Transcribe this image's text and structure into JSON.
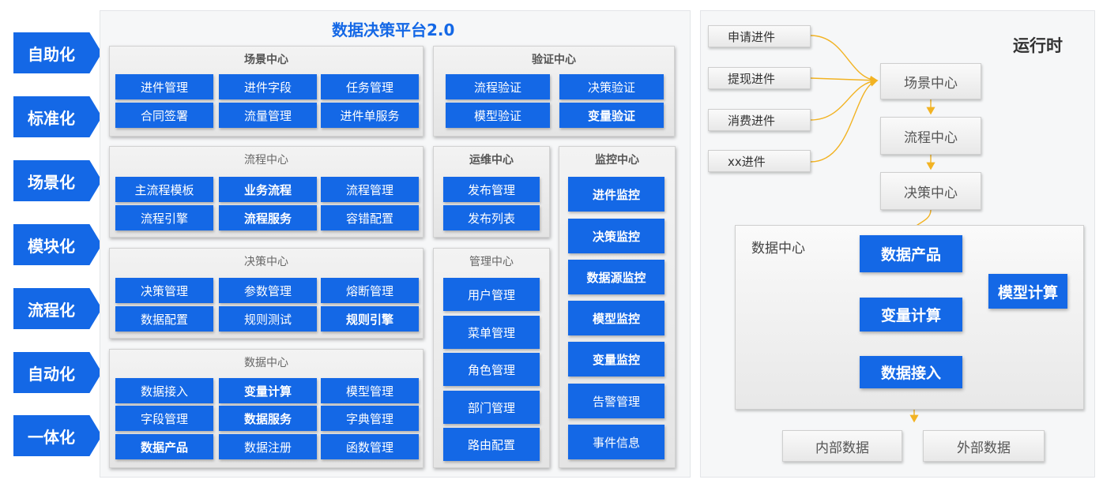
{
  "title": "数据决策平台2.0",
  "left_labels": [
    "自助化",
    "标准化",
    "场景化",
    "模块化",
    "流程化",
    "自动化",
    "一体化"
  ],
  "scene_center": {
    "title": "场景中心",
    "items": [
      {
        "label": "进件管理",
        "bold": false
      },
      {
        "label": "进件字段",
        "bold": false
      },
      {
        "label": "任务管理",
        "bold": false
      },
      {
        "label": "合同签署",
        "bold": false
      },
      {
        "label": "流量管理",
        "bold": false
      },
      {
        "label": "进件单服务",
        "bold": false
      }
    ]
  },
  "verify_center": {
    "title": "验证中心",
    "items": [
      {
        "label": "流程验证",
        "bold": false
      },
      {
        "label": "决策验证",
        "bold": false
      },
      {
        "label": "模型验证",
        "bold": false
      },
      {
        "label": "变量验证",
        "bold": true
      }
    ]
  },
  "flow_center": {
    "title": "流程中心",
    "items": [
      {
        "label": "主流程模板",
        "bold": false
      },
      {
        "label": "业务流程",
        "bold": true
      },
      {
        "label": "流程管理",
        "bold": false
      },
      {
        "label": "流程引擎",
        "bold": false
      },
      {
        "label": "流程服务",
        "bold": true
      },
      {
        "label": "容错配置",
        "bold": false
      }
    ]
  },
  "ops_center": {
    "title": "运维中心",
    "items": [
      {
        "label": "发布管理",
        "bold": false
      },
      {
        "label": "发布列表",
        "bold": false
      }
    ]
  },
  "monitor_center": {
    "title": "监控中心",
    "items": [
      {
        "label": "进件监控",
        "bold": true
      },
      {
        "label": "决策监控",
        "bold": true
      },
      {
        "label": "数据源监控",
        "bold": true
      },
      {
        "label": "模型监控",
        "bold": true
      },
      {
        "label": "变量监控",
        "bold": true
      },
      {
        "label": "告警管理",
        "bold": false
      },
      {
        "label": "事件信息",
        "bold": false
      }
    ]
  },
  "decision_center": {
    "title": "决策中心",
    "items": [
      {
        "label": "决策管理",
        "bold": false
      },
      {
        "label": "参数管理",
        "bold": false
      },
      {
        "label": "熔断管理",
        "bold": false
      },
      {
        "label": "数据配置",
        "bold": false
      },
      {
        "label": "规则测试",
        "bold": false
      },
      {
        "label": "规则引擎",
        "bold": true
      }
    ]
  },
  "manage_center": {
    "title": "管理中心",
    "items": [
      {
        "label": "用户管理",
        "bold": false
      },
      {
        "label": "菜单管理",
        "bold": false
      },
      {
        "label": "角色管理",
        "bold": false
      },
      {
        "label": "部门管理",
        "bold": false
      },
      {
        "label": "路由配置",
        "bold": false
      }
    ]
  },
  "data_center": {
    "title": "数据中心",
    "items": [
      {
        "label": "数据接入",
        "bold": false
      },
      {
        "label": "变量计算",
        "bold": true
      },
      {
        "label": "模型管理",
        "bold": false
      },
      {
        "label": "字段管理",
        "bold": false
      },
      {
        "label": "数据服务",
        "bold": true
      },
      {
        "label": "字典管理",
        "bold": false
      },
      {
        "label": "数据产品",
        "bold": true
      },
      {
        "label": "数据注册",
        "bold": false
      },
      {
        "label": "函数管理",
        "bold": false
      }
    ]
  },
  "runtime": {
    "title": "运行时",
    "inputs": [
      "申请进件",
      "提现进件",
      "消费进件",
      "xx进件"
    ],
    "chain": [
      "场景中心",
      "流程中心",
      "决策中心"
    ],
    "data_center": {
      "title": "数据中心",
      "product": "数据产品",
      "variable": "变量计算",
      "model": "模型计算",
      "access": "数据接入"
    },
    "sources": [
      "内部数据",
      "外部数据"
    ]
  },
  "colors": {
    "blue": "#1468e6",
    "arrow": "#f2b323",
    "panel": "#e8e8e8"
  }
}
